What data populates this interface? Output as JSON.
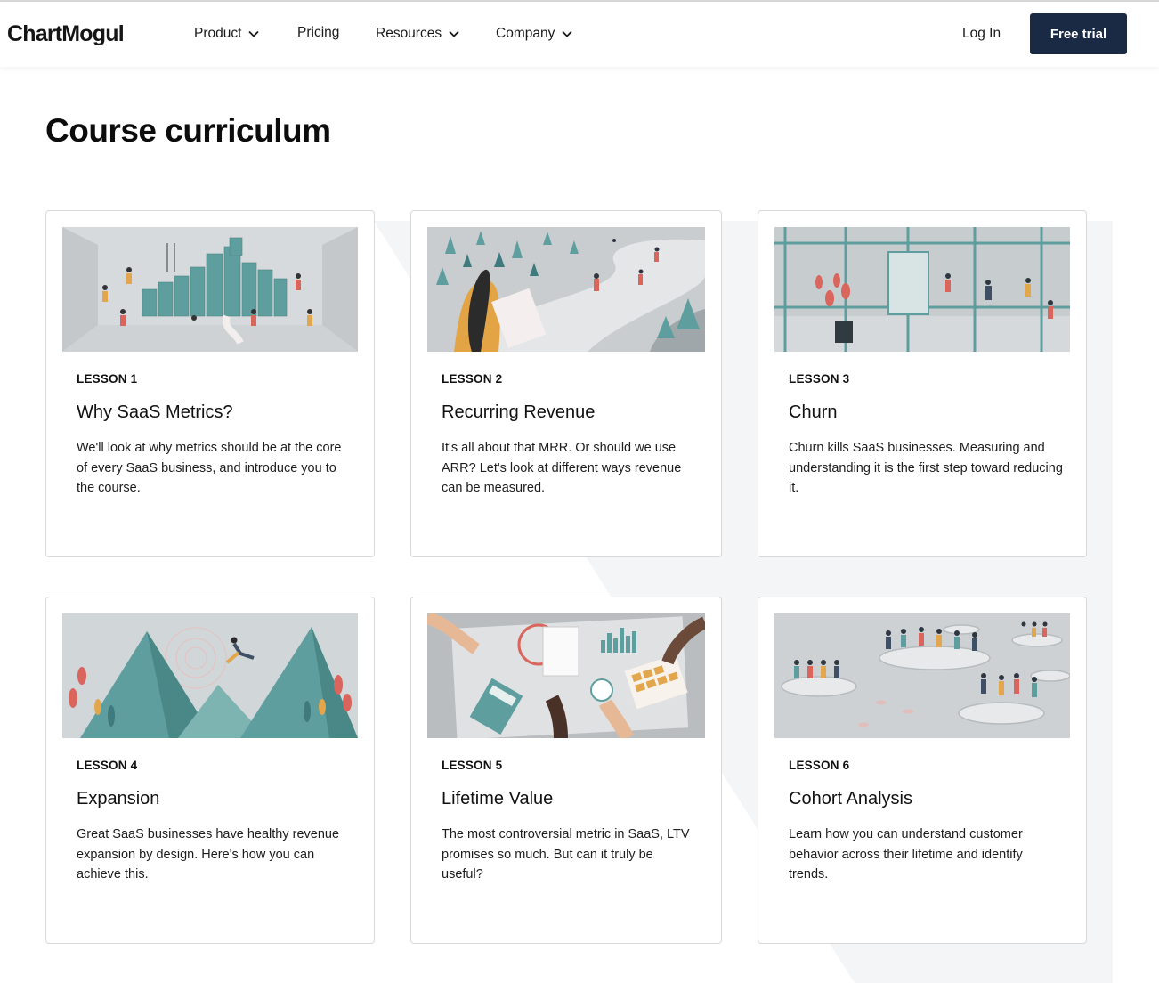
{
  "brand": {
    "logo": "ChartMogul"
  },
  "nav": {
    "items": [
      {
        "label": "Product",
        "has_dropdown": true
      },
      {
        "label": "Pricing",
        "has_dropdown": false
      },
      {
        "label": "Resources",
        "has_dropdown": true
      },
      {
        "label": "Company",
        "has_dropdown": true
      }
    ],
    "login": "Log In",
    "cta": "Free trial"
  },
  "page": {
    "heading": "Course curriculum"
  },
  "lessons": [
    {
      "tag": "LESSON 1",
      "title": "Why SaaS Metrics?",
      "desc": "We'll look at why metrics should be at the core of every SaaS business, and introduce you to the course.",
      "illustration": "bar-chart-city-illustration"
    },
    {
      "tag": "LESSON 2",
      "title": "Recurring Revenue",
      "desc": "It's all about that MRR. Or should we use ARR? Let's look at different ways revenue can be measured.",
      "illustration": "winding-road-illustration"
    },
    {
      "tag": "LESSON 3",
      "title": "Churn",
      "desc": "Churn kills SaaS businesses. Measuring and understanding it is the first step toward reducing it.",
      "illustration": "revolving-door-illustration"
    },
    {
      "tag": "LESSON 4",
      "title": "Expansion",
      "desc": "Great SaaS businesses have healthy revenue expansion by design. Here's how you can achieve this.",
      "illustration": "mountains-illustration"
    },
    {
      "tag": "LESSON 5",
      "title": "Lifetime Value",
      "desc": "The most controversial metric in SaaS, LTV promises so much. But can it truly be useful?",
      "illustration": "calculator-hands-illustration"
    },
    {
      "tag": "LESSON 6",
      "title": "Cohort Analysis",
      "desc": "Learn how you can understand customer behavior across their lifetime and identify trends.",
      "illustration": "crowd-platforms-illustration"
    }
  ],
  "colors": {
    "cta_bg": "#1b2a44",
    "teal": "#5f9e9e",
    "backdrop": "#f4f5f7"
  }
}
